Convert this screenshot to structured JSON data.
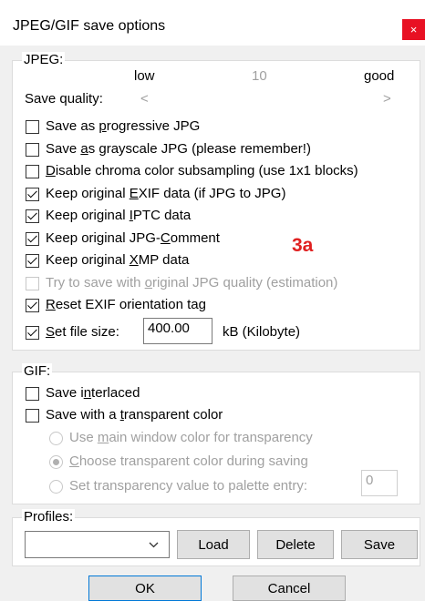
{
  "window": {
    "title": "JPEG/GIF save options",
    "close_glyph": "×"
  },
  "jpeg": {
    "group_label": "JPEG:",
    "quality": {
      "low_label": "low",
      "value": "10",
      "good_label": "good",
      "label": "Save quality:",
      "left_arrow": "<",
      "right_arrow": ">"
    },
    "options": [
      {
        "pre": "Save as ",
        "u": "p",
        "post": "rogressive JPG",
        "checked": false,
        "disabled": false
      },
      {
        "pre": "Save ",
        "u": "a",
        "post": "s grayscale JPG (please remember!)",
        "checked": false,
        "disabled": false
      },
      {
        "pre": "",
        "u": "D",
        "post": "isable chroma color subsampling (use 1x1 blocks)",
        "checked": false,
        "disabled": false
      },
      {
        "pre": "Keep original ",
        "u": "E",
        "post": "XIF data (if JPG to JPG)",
        "checked": true,
        "disabled": false
      },
      {
        "pre": "Keep original ",
        "u": "I",
        "post": "PTC data",
        "checked": true,
        "disabled": false
      },
      {
        "pre": "Keep original JPG-",
        "u": "C",
        "post": "omment",
        "checked": true,
        "disabled": false
      },
      {
        "pre": "Keep original ",
        "u": "X",
        "post": "MP data",
        "checked": true,
        "disabled": false
      },
      {
        "pre": "Try to save with ",
        "u": "o",
        "post": "riginal JPG quality (estimation)",
        "checked": false,
        "disabled": true
      },
      {
        "pre": "",
        "u": "R",
        "post": "eset EXIF orientation tag",
        "checked": true,
        "disabled": false
      }
    ],
    "file_size": {
      "pre": "",
      "u": "S",
      "post": "et file size:",
      "checked": true,
      "value": "400.00",
      "unit": "kB (Kilobyte)"
    }
  },
  "annotation": "3a",
  "gif": {
    "group_label": "GIF:",
    "save_interlaced": {
      "pre": "Save i",
      "u": "n",
      "post": "terlaced",
      "checked": false
    },
    "save_transparent": {
      "pre": "Save with a ",
      "u": "t",
      "post": "ransparent color",
      "checked": false
    },
    "radios": [
      {
        "pre": "Use ",
        "u": "m",
        "post": "ain window color for transparency",
        "selected": false
      },
      {
        "pre": "",
        "u": "C",
        "post": "hoose transparent color during saving",
        "selected": true
      },
      {
        "pre": "Set transparency value to palette entry:",
        "u": "",
        "post": "",
        "selected": false
      }
    ],
    "palette_value": "0"
  },
  "profiles": {
    "group_label": "Profiles:",
    "selected": "",
    "load_label": "Load",
    "delete_label": "Delete",
    "save_label": "Save"
  },
  "footer": {
    "ok_label": "OK",
    "cancel_label": "Cancel"
  }
}
